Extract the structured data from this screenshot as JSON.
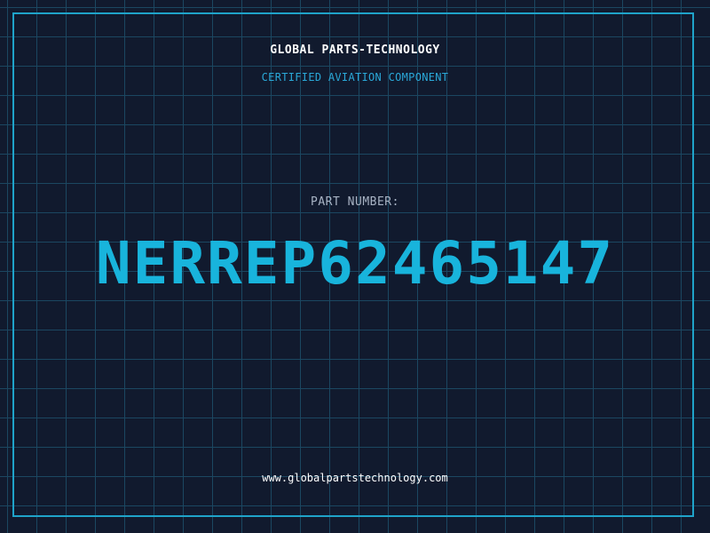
{
  "header": {
    "company": "GLOBAL PARTS-TECHNOLOGY",
    "subtitle": "CERTIFIED AVIATION COMPONENT"
  },
  "part": {
    "label": "PART NUMBER:",
    "number": "NERREP62465147"
  },
  "footer": {
    "website": "www.globalpartstechnology.com"
  },
  "colors": {
    "background": "#111a2e",
    "grid": "#1d4f6b",
    "accent": "#18b4dc",
    "frame": "#1fa3c9"
  }
}
